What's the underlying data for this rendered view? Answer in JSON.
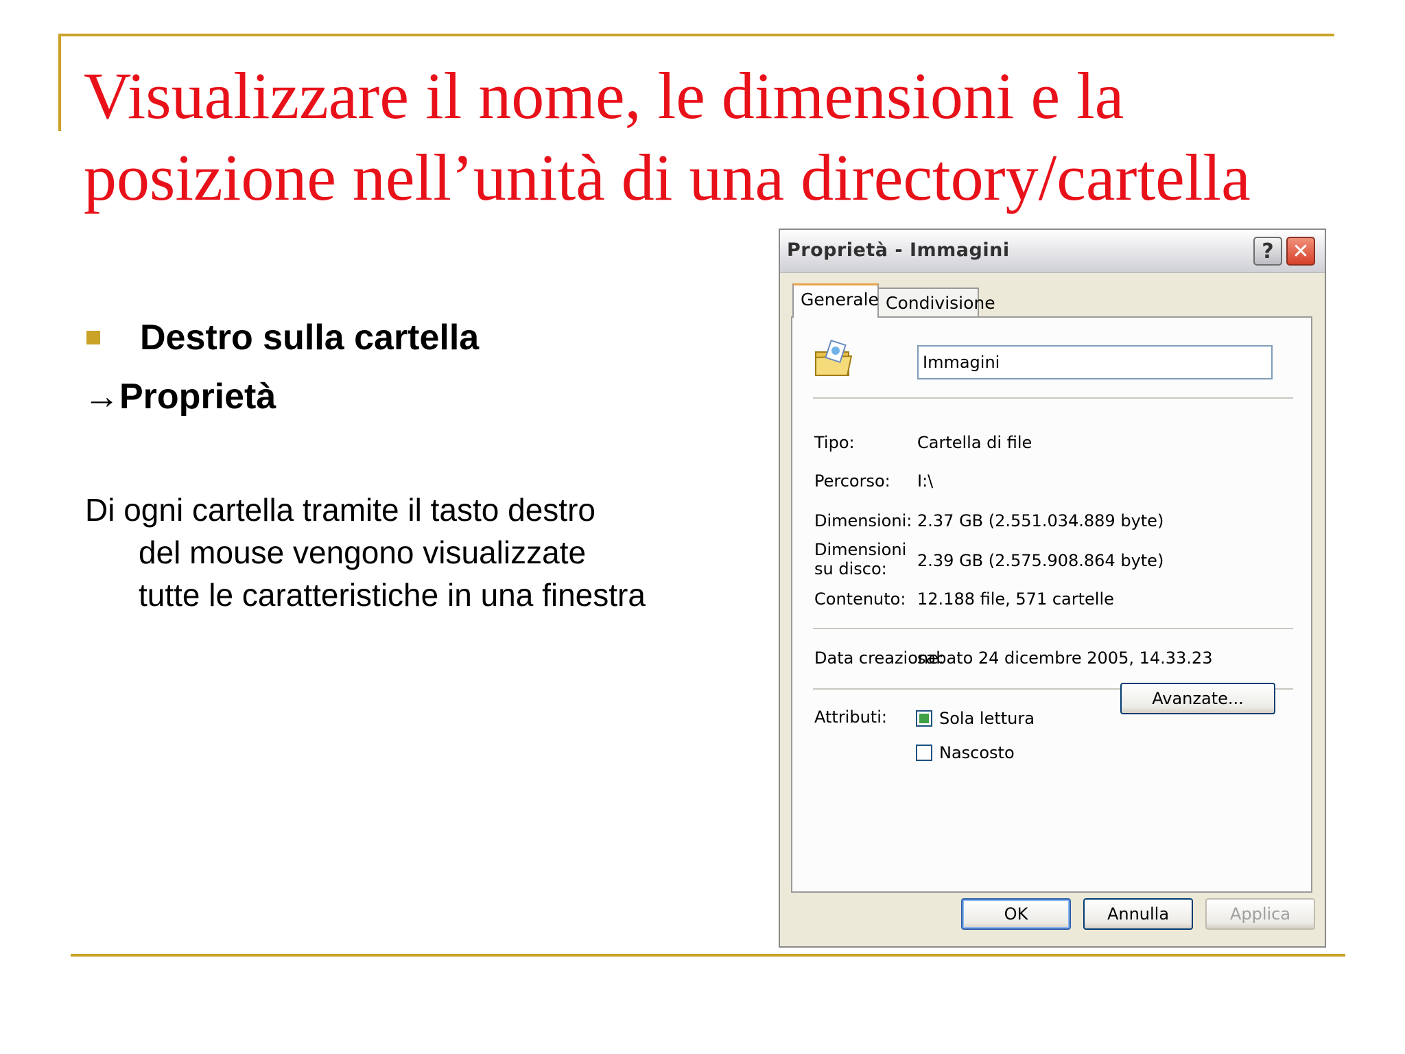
{
  "slide": {
    "title_line1": "Visualizzare il nome, le dimensioni e la",
    "title_line2": "posizione nell’unità di una directory/cartella",
    "bullet": "Destro sulla cartella",
    "arrow_line": "→Proprietà",
    "para_line1": "Di ogni cartella tramite il tasto destro",
    "para_line2": "del mouse vengono visualizzate",
    "para_line3": "tutte le caratteristiche in una finestra",
    "accent_color": "#c9a227",
    "title_color": "#e8111a"
  },
  "dialog": {
    "title": "Proprietà - Immagini",
    "help_glyph": "?",
    "close_glyph": "✕",
    "tabs": [
      {
        "label": "Generale",
        "active": true
      },
      {
        "label": "Condivisione",
        "active": false
      }
    ],
    "folder_icon": "folder-icon",
    "name_value": "Immagini",
    "fields": {
      "tipo_label": "Tipo:",
      "tipo_value": "Cartella di file",
      "percorso_label": "Percorso:",
      "percorso_value": "I:\\",
      "dimensioni_label": "Dimensioni:",
      "dimensioni_value": "2.37 GB (2.551.034.889 byte)",
      "disco_label": "Dimensioni su disco:",
      "disco_value": "2.39 GB (2.575.908.864 byte)",
      "contenuto_label": "Contenuto:",
      "contenuto_value": "12.188 file, 571 cartelle",
      "creazione_label": "Data creazione:",
      "creazione_value": "sabato 24 dicembre 2005, 14.33.23",
      "attributi_label": "Attributi:"
    },
    "attributes": {
      "sola_lettura_label": "Sola lettura",
      "sola_lettura_checked": true,
      "nascosto_label": "Nascosto",
      "nascosto_checked": false
    },
    "buttons": {
      "avanzate": "Avanzate...",
      "ok": "OK",
      "annulla": "Annulla",
      "applica": "Applica"
    }
  }
}
